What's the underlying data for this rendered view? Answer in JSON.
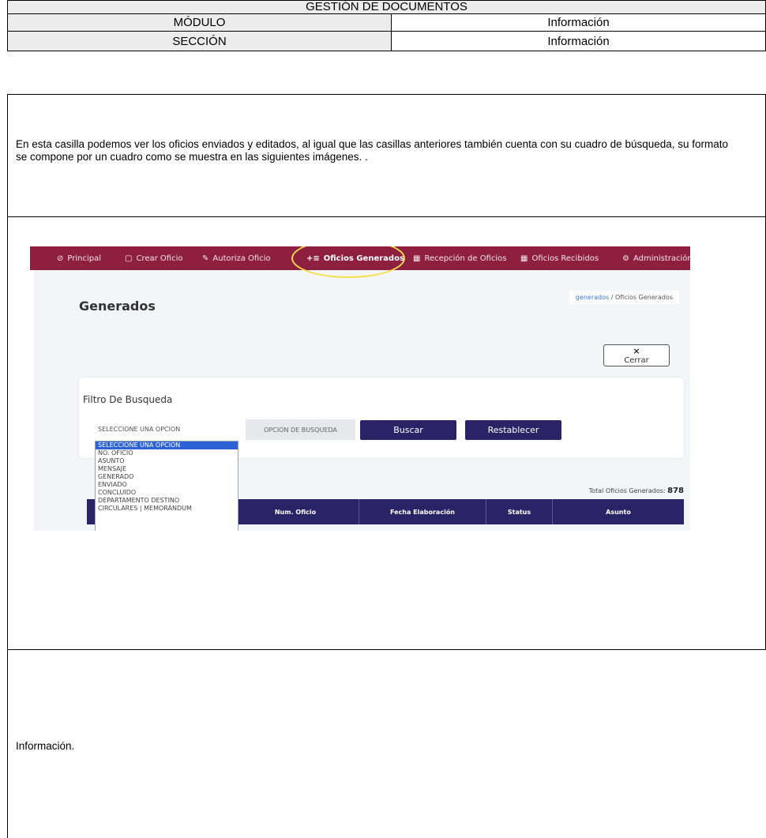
{
  "header": {
    "title": "GESTIÓN DE DOCUMENTOS",
    "modulo_label": "MÓDULO",
    "modulo_value": "Información",
    "seccion_label": "SECCIÓN",
    "seccion_value": "Información"
  },
  "description": "En esta casilla podemos ver los oficios enviados y editados, al igual que las casillas anteriores también cuenta con su cuadro de búsqueda, su formato se compone por un cuadro como se muestra en las siguientes imágenes. .",
  "screenshot": {
    "nav": [
      {
        "label": "Principal",
        "icon": "⊘"
      },
      {
        "label": "Crear Oficio",
        "icon": "▢"
      },
      {
        "label": "Autoriza Oficio",
        "icon": "✎"
      },
      {
        "label": "Oficios Generados",
        "icon": "+≡"
      },
      {
        "label": "Recepción de Oficios",
        "icon": "▦"
      },
      {
        "label": "Oficios Recibidos",
        "icon": "▦"
      },
      {
        "label": "Administración",
        "icon": "⚙"
      }
    ],
    "page_title": "Generados",
    "breadcrumb_link": "generados",
    "breadcrumb_sep": "/",
    "breadcrumb_current": "Oficios Generados",
    "close_icon": "×",
    "close_label": "Cerrar",
    "filter_title": "Filtro De Busqueda",
    "select_value": "SELECCIONE UNA OPCION",
    "search_placeholder": "OPCION DE BUSQUEDA",
    "search_button": "Buscar",
    "reset_button": "Restablecer",
    "dropdown_options": [
      "SELECCIONE UNA OPCION",
      "NO. OFICIO",
      "ASUNTO",
      "MENSAJE",
      "GENERADO",
      "ENVIADO",
      "CONCLUIDO",
      "DEPARTAMENTO DESTINO",
      "CIRCULARES | MEMORÁNDUM"
    ],
    "total_label": "Total Oficios Generados:",
    "total_value": "878",
    "table_headers": [
      "Num. Oficio",
      "Fecha Elaboración",
      "Status",
      "Asunto"
    ]
  },
  "footer_text": "Información."
}
